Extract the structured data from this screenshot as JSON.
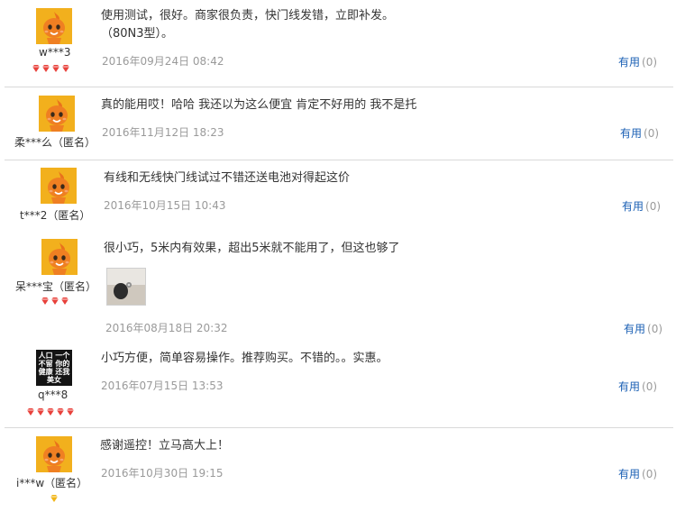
{
  "reviews": [
    {
      "user": "w***3",
      "content_lines": [
        "使用测试，很好。商家很负责，快门线发错，立即补发。",
        "（80N3型）。"
      ],
      "date": "2016年09月24日 08:42",
      "useful_label": "有用",
      "useful_count": "(0)",
      "badge_count": 4,
      "avatar": "mascot"
    },
    {
      "user": "柔***么（匿名）",
      "content_lines": [
        "真的能用哎！哈哈 我还以为这么便宜 肯定不好用的 我不是托"
      ],
      "date": "2016年11月12日 18:23",
      "useful_label": "有用",
      "useful_count": "(0)",
      "badge_count": 0,
      "avatar": "mascot"
    },
    {
      "user": "t***2（匿名）",
      "content_lines": [
        "有线和无线快门线试过不错还送电池对得起这价"
      ],
      "date": "2016年10月15日 10:43",
      "useful_label": "有用",
      "useful_count": "(0)",
      "badge_count": 0,
      "avatar": "mascot"
    },
    {
      "user": "呆***宝（匿名）",
      "content_lines": [
        "很小巧，5米内有效果，超出5米就不能用了，但这也够了"
      ],
      "date": "2016年08月18日 20:32",
      "useful_label": "有用",
      "useful_count": "(0)",
      "badge_count": 3,
      "avatar": "mascot",
      "has_image": true
    },
    {
      "user": "q***8",
      "content_lines": [
        "小巧方便，简单容易操作。推荐购买。不错的。。实惠。"
      ],
      "date": "2016年07月15日 13:53",
      "useful_label": "有用",
      "useful_count": "(0)",
      "badge_count": 5,
      "avatar": "dark",
      "avatar_text": "人口 一个不留 你的健康 还我美女"
    },
    {
      "user": "i***w（匿名）",
      "content_lines": [
        "感谢遥控！立马高大上！"
      ],
      "date": "2016年10月30日 19:15",
      "useful_label": "有用",
      "useful_count": "(0)",
      "badge_count": 1,
      "badge_style": "gold",
      "avatar": "mascot"
    }
  ],
  "colors": {
    "link": "#1a5fb4",
    "muted": "#9a9a9a",
    "badge": "#e8413b",
    "avatar_bg": "#f2b01d"
  }
}
